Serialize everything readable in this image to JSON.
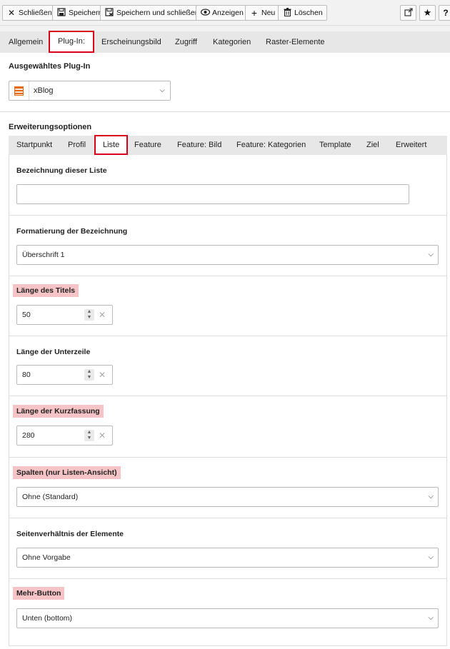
{
  "toolbar": {
    "close_label": "Schließen",
    "save_label": "Speichern",
    "save_close_label": "Speichern und schließen",
    "view_label": "Anzeigen",
    "new_label": "Neu",
    "delete_label": "Löschen",
    "icons": [
      "close-icon",
      "save-icon",
      "save-close-icon",
      "eye-icon",
      "plus-icon",
      "trash-icon",
      "external-link-icon",
      "star-icon",
      "help-icon"
    ]
  },
  "main_tabs": [
    "Allgemein",
    "Plug-In:",
    "Erscheinungsbild",
    "Zugriff",
    "Kategorien",
    "Raster-Elemente"
  ],
  "main_tab_active": "Plug-In:",
  "plugin": {
    "section_title": "Ausgewähltes Plug-In",
    "selected": "xBlog"
  },
  "extensions": {
    "section_title": "Erweiterungsoptionen",
    "tabs": [
      "Startpunkt",
      "Profil",
      "Liste",
      "Feature",
      "Feature: Bild",
      "Feature: Kategorien",
      "Template",
      "Ziel",
      "Erweitert"
    ],
    "active_tab": "Liste"
  },
  "fields": {
    "list_name": {
      "label": "Bezeichnung dieser Liste",
      "value": ""
    },
    "format": {
      "label": "Formatierung der Bezeichnung",
      "value": "Überschrift 1"
    },
    "title_length": {
      "label": "Länge des Titels",
      "value": "50"
    },
    "subline_length": {
      "label": "Länge der Unterzeile",
      "value": "80"
    },
    "summary_length": {
      "label": "Länge der Kurzfassung",
      "value": "280"
    },
    "columns": {
      "label": "Spalten (nur Listen-Ansicht)",
      "value": "Ohne (Standard)"
    },
    "aspect_ratio": {
      "label": "Seitenverhältnis der Elemente",
      "value": "Ohne Vorgabe"
    },
    "more_button": {
      "label": "Mehr-Button",
      "value": "Unten (bottom)"
    }
  },
  "colors": {
    "highlight": "#f6c3c6",
    "active_tab_border": "#d9001a",
    "plugin_icon": "#e36a16"
  }
}
